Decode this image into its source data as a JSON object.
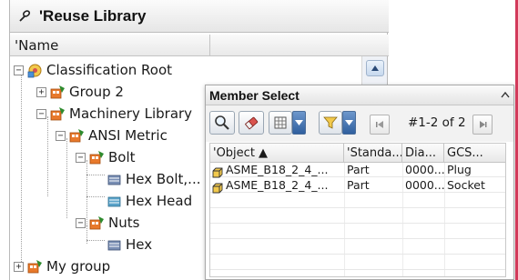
{
  "panel": {
    "title": "'Reuse Library",
    "pin_icon": "pin-icon",
    "column_header": "'Name"
  },
  "tree": [
    {
      "label": "Classification Root",
      "icon": "classification-root-icon",
      "expanded": true
    },
    {
      "label": "Group 2",
      "icon": "group-icon",
      "expanded": false
    },
    {
      "label": "Machinery Library",
      "icon": "group-icon",
      "expanded": true
    },
    {
      "label": "ANSI Metric",
      "icon": "group-icon",
      "expanded": true
    },
    {
      "label": "Bolt",
      "icon": "group-icon",
      "expanded": true
    },
    {
      "label": "Hex Bolt,...",
      "icon": "class-icon"
    },
    {
      "label": "Hex Head",
      "icon": "class-icon"
    },
    {
      "label": "Nuts",
      "icon": "group-icon",
      "expanded": true
    },
    {
      "label": "Hex",
      "icon": "class-icon"
    },
    {
      "label": "My group",
      "icon": "group-icon",
      "expanded": false
    }
  ],
  "member_select": {
    "title": "Member Select",
    "collapse_icon": "chevron-up-icon",
    "toolbar": {
      "search_icon": "search-icon",
      "eraser_icon": "eraser-icon",
      "view_icon": "grid-view-icon",
      "filter_icon": "filter-icon",
      "first_page_icon": "first-page-icon",
      "page_count": "#1-2 of 2",
      "next_page_icon": "next-page-icon"
    },
    "columns": [
      "'Object ▲",
      "'Standa...",
      "Dia...",
      "GCS..."
    ],
    "rows": [
      [
        "ASME_B18_2_4_...",
        "Part",
        "0000...",
        "Plug"
      ],
      [
        "ASME_B18_2_4_...",
        "Part",
        "0000...",
        "Socket"
      ]
    ]
  },
  "colors": {
    "accent_blue": "#2f5f9e",
    "edge_pink": "#d23a5a",
    "folder_orange": "#e8792b",
    "tree_green": "#2e8b2e"
  }
}
